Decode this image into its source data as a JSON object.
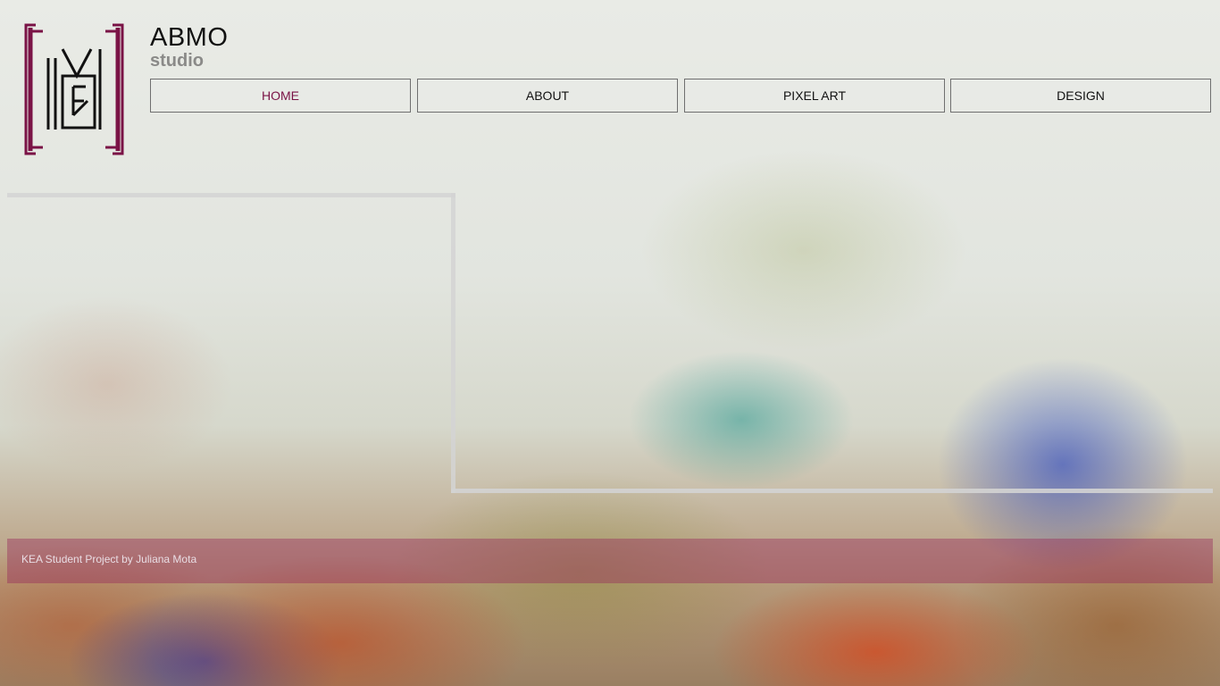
{
  "brand": {
    "title": "ABMO",
    "subtitle": "studio",
    "logo_icon": "abmo-monogram-icon",
    "accent_color": "#7a1346"
  },
  "nav": {
    "items": [
      {
        "label": "HOME",
        "active": true
      },
      {
        "label": "ABOUT",
        "active": false
      },
      {
        "label": "PIXEL ART",
        "active": false
      },
      {
        "label": "DESIGN",
        "active": false
      }
    ]
  },
  "footer": {
    "text": "KEA Student Project by Juliana Mota"
  }
}
